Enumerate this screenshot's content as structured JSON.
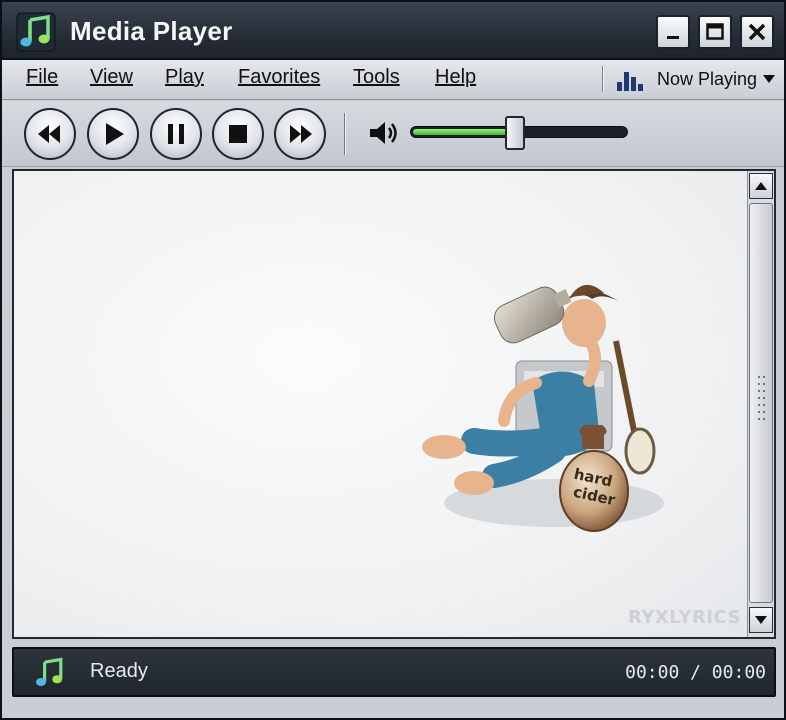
{
  "window": {
    "title": "Media Player",
    "controls": {
      "minimize": "minimize-icon",
      "maximize": "maximize-icon",
      "close": "close-icon"
    }
  },
  "menu": {
    "items": [
      {
        "label": "File",
        "accel": "F"
      },
      {
        "label": "View",
        "accel": "V"
      },
      {
        "label": "Play",
        "accel": "P"
      },
      {
        "label": "Favorites",
        "accel": "F"
      },
      {
        "label": "Tools",
        "accel": "T"
      },
      {
        "label": "Help",
        "accel": "H"
      }
    ],
    "now_playing": "Now Playing"
  },
  "toolbar": {
    "buttons": [
      "rewind-icon",
      "play-icon",
      "pause-icon",
      "stop-icon",
      "fast-forward-icon"
    ],
    "volume_level": 0.48,
    "volume_fill_color": "#3dbb2c"
  },
  "video": {
    "watermark": "RYXLYRICS",
    "jug_label_line1": "hard",
    "jug_label_line2": "cider"
  },
  "status": {
    "text": "Ready",
    "time": "00:00 / 00:00"
  },
  "colors": {
    "titlebar": "#262d36",
    "chrome": "#c9ced5",
    "accent_green": "#3dbb2c",
    "statusbar": "#20262d"
  }
}
